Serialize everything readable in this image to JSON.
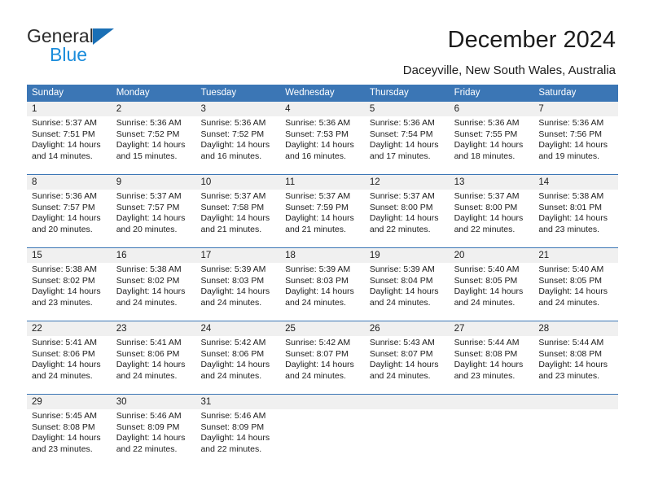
{
  "brand": {
    "name_top": "General",
    "name_bottom": "Blue",
    "accent_blue": "#1a6fb5",
    "light_blue": "#1a8cdb"
  },
  "header": {
    "title": "December 2024",
    "subtitle": "Daceyville, New South Wales, Australia"
  },
  "calendar": {
    "header_bg": "#3b76b5",
    "daynum_bg": "#f0f0f0",
    "weekdays": [
      "Sunday",
      "Monday",
      "Tuesday",
      "Wednesday",
      "Thursday",
      "Friday",
      "Saturday"
    ],
    "weeks": [
      [
        {
          "day": "1",
          "lines": [
            "Sunrise: 5:37 AM",
            "Sunset: 7:51 PM",
            "Daylight: 14 hours",
            "and 14 minutes."
          ]
        },
        {
          "day": "2",
          "lines": [
            "Sunrise: 5:36 AM",
            "Sunset: 7:52 PM",
            "Daylight: 14 hours",
            "and 15 minutes."
          ]
        },
        {
          "day": "3",
          "lines": [
            "Sunrise: 5:36 AM",
            "Sunset: 7:52 PM",
            "Daylight: 14 hours",
            "and 16 minutes."
          ]
        },
        {
          "day": "4",
          "lines": [
            "Sunrise: 5:36 AM",
            "Sunset: 7:53 PM",
            "Daylight: 14 hours",
            "and 16 minutes."
          ]
        },
        {
          "day": "5",
          "lines": [
            "Sunrise: 5:36 AM",
            "Sunset: 7:54 PM",
            "Daylight: 14 hours",
            "and 17 minutes."
          ]
        },
        {
          "day": "6",
          "lines": [
            "Sunrise: 5:36 AM",
            "Sunset: 7:55 PM",
            "Daylight: 14 hours",
            "and 18 minutes."
          ]
        },
        {
          "day": "7",
          "lines": [
            "Sunrise: 5:36 AM",
            "Sunset: 7:56 PM",
            "Daylight: 14 hours",
            "and 19 minutes."
          ]
        }
      ],
      [
        {
          "day": "8",
          "lines": [
            "Sunrise: 5:36 AM",
            "Sunset: 7:57 PM",
            "Daylight: 14 hours",
            "and 20 minutes."
          ]
        },
        {
          "day": "9",
          "lines": [
            "Sunrise: 5:37 AM",
            "Sunset: 7:57 PM",
            "Daylight: 14 hours",
            "and 20 minutes."
          ]
        },
        {
          "day": "10",
          "lines": [
            "Sunrise: 5:37 AM",
            "Sunset: 7:58 PM",
            "Daylight: 14 hours",
            "and 21 minutes."
          ]
        },
        {
          "day": "11",
          "lines": [
            "Sunrise: 5:37 AM",
            "Sunset: 7:59 PM",
            "Daylight: 14 hours",
            "and 21 minutes."
          ]
        },
        {
          "day": "12",
          "lines": [
            "Sunrise: 5:37 AM",
            "Sunset: 8:00 PM",
            "Daylight: 14 hours",
            "and 22 minutes."
          ]
        },
        {
          "day": "13",
          "lines": [
            "Sunrise: 5:37 AM",
            "Sunset: 8:00 PM",
            "Daylight: 14 hours",
            "and 22 minutes."
          ]
        },
        {
          "day": "14",
          "lines": [
            "Sunrise: 5:38 AM",
            "Sunset: 8:01 PM",
            "Daylight: 14 hours",
            "and 23 minutes."
          ]
        }
      ],
      [
        {
          "day": "15",
          "lines": [
            "Sunrise: 5:38 AM",
            "Sunset: 8:02 PM",
            "Daylight: 14 hours",
            "and 23 minutes."
          ]
        },
        {
          "day": "16",
          "lines": [
            "Sunrise: 5:38 AM",
            "Sunset: 8:02 PM",
            "Daylight: 14 hours",
            "and 24 minutes."
          ]
        },
        {
          "day": "17",
          "lines": [
            "Sunrise: 5:39 AM",
            "Sunset: 8:03 PM",
            "Daylight: 14 hours",
            "and 24 minutes."
          ]
        },
        {
          "day": "18",
          "lines": [
            "Sunrise: 5:39 AM",
            "Sunset: 8:03 PM",
            "Daylight: 14 hours",
            "and 24 minutes."
          ]
        },
        {
          "day": "19",
          "lines": [
            "Sunrise: 5:39 AM",
            "Sunset: 8:04 PM",
            "Daylight: 14 hours",
            "and 24 minutes."
          ]
        },
        {
          "day": "20",
          "lines": [
            "Sunrise: 5:40 AM",
            "Sunset: 8:05 PM",
            "Daylight: 14 hours",
            "and 24 minutes."
          ]
        },
        {
          "day": "21",
          "lines": [
            "Sunrise: 5:40 AM",
            "Sunset: 8:05 PM",
            "Daylight: 14 hours",
            "and 24 minutes."
          ]
        }
      ],
      [
        {
          "day": "22",
          "lines": [
            "Sunrise: 5:41 AM",
            "Sunset: 8:06 PM",
            "Daylight: 14 hours",
            "and 24 minutes."
          ]
        },
        {
          "day": "23",
          "lines": [
            "Sunrise: 5:41 AM",
            "Sunset: 8:06 PM",
            "Daylight: 14 hours",
            "and 24 minutes."
          ]
        },
        {
          "day": "24",
          "lines": [
            "Sunrise: 5:42 AM",
            "Sunset: 8:06 PM",
            "Daylight: 14 hours",
            "and 24 minutes."
          ]
        },
        {
          "day": "25",
          "lines": [
            "Sunrise: 5:42 AM",
            "Sunset: 8:07 PM",
            "Daylight: 14 hours",
            "and 24 minutes."
          ]
        },
        {
          "day": "26",
          "lines": [
            "Sunrise: 5:43 AM",
            "Sunset: 8:07 PM",
            "Daylight: 14 hours",
            "and 24 minutes."
          ]
        },
        {
          "day": "27",
          "lines": [
            "Sunrise: 5:44 AM",
            "Sunset: 8:08 PM",
            "Daylight: 14 hours",
            "and 23 minutes."
          ]
        },
        {
          "day": "28",
          "lines": [
            "Sunrise: 5:44 AM",
            "Sunset: 8:08 PM",
            "Daylight: 14 hours",
            "and 23 minutes."
          ]
        }
      ],
      [
        {
          "day": "29",
          "lines": [
            "Sunrise: 5:45 AM",
            "Sunset: 8:08 PM",
            "Daylight: 14 hours",
            "and 23 minutes."
          ]
        },
        {
          "day": "30",
          "lines": [
            "Sunrise: 5:46 AM",
            "Sunset: 8:09 PM",
            "Daylight: 14 hours",
            "and 22 minutes."
          ]
        },
        {
          "day": "31",
          "lines": [
            "Sunrise: 5:46 AM",
            "Sunset: 8:09 PM",
            "Daylight: 14 hours",
            "and 22 minutes."
          ]
        },
        {
          "day": "",
          "lines": []
        },
        {
          "day": "",
          "lines": []
        },
        {
          "day": "",
          "lines": []
        },
        {
          "day": "",
          "lines": []
        }
      ]
    ]
  }
}
